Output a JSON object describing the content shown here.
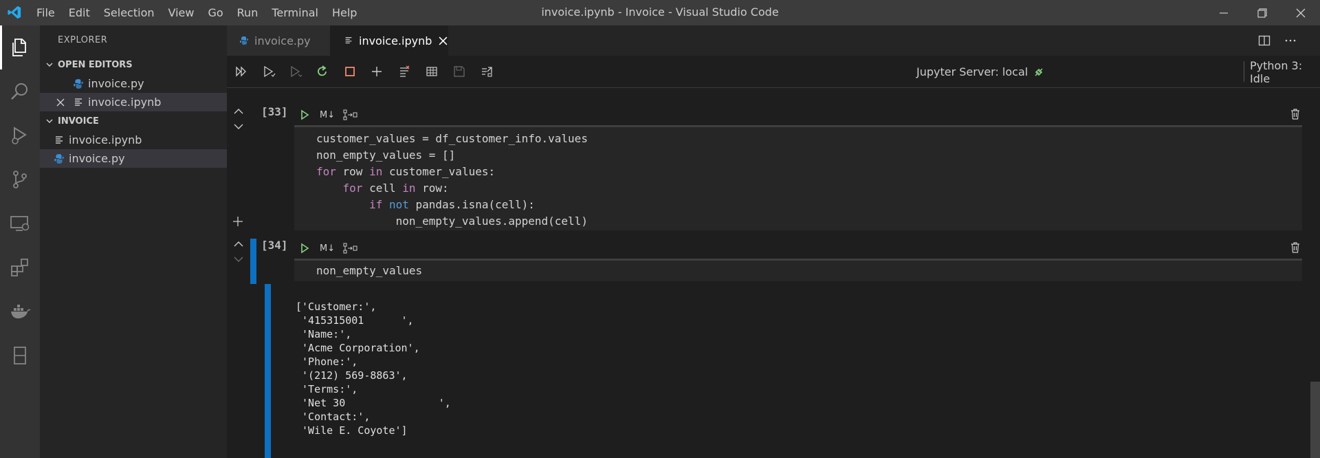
{
  "window": {
    "title": "invoice.ipynb - Invoice - Visual Studio Code",
    "menu": [
      "File",
      "Edit",
      "Selection",
      "View",
      "Go",
      "Run",
      "Terminal",
      "Help"
    ]
  },
  "sidebar": {
    "title": "EXPLORER",
    "open_editors_label": "OPEN EDITORS",
    "open_editors": [
      {
        "name": "invoice.py",
        "icon": "python-file-icon"
      },
      {
        "name": "invoice.ipynb",
        "icon": "notebook-file-icon"
      }
    ],
    "folder_label": "INVOICE",
    "files": [
      {
        "name": "invoice.ipynb",
        "icon": "notebook-file-icon"
      },
      {
        "name": "invoice.py",
        "icon": "python-file-icon"
      }
    ]
  },
  "tabs": [
    {
      "label": "invoice.py",
      "active": false
    },
    {
      "label": "invoice.ipynb",
      "active": true
    }
  ],
  "toolbar": {
    "kernel_server": "Jupyter Server: local",
    "kernel_status": "Python 3: Idle"
  },
  "cells": [
    {
      "prompt": "[33]",
      "markdown_toggle": "M↓",
      "code_lines": [
        "customer_values = df_customer_info.values",
        "non_empty_values = []",
        "for row in customer_values:",
        "    for cell in row:",
        "        if not pandas.isna(cell):",
        "            non_empty_values.append(cell)"
      ]
    },
    {
      "prompt": "[34]",
      "markdown_toggle": "M↓",
      "code_lines": [
        "non_empty_values"
      ],
      "output": "['Customer:',\n '415315001      ',\n 'Name:',\n 'Acme Corporation',\n 'Phone:',\n '(212) 569-8863',\n 'Terms:',\n 'Net 30               ',\n 'Contact:',\n 'Wile E. Coyote']"
    }
  ],
  "colors": {
    "accent": "#0e70c0",
    "keyword": "#c586c0",
    "keyword_blue": "#569cd6",
    "run_green": "#89d185"
  }
}
